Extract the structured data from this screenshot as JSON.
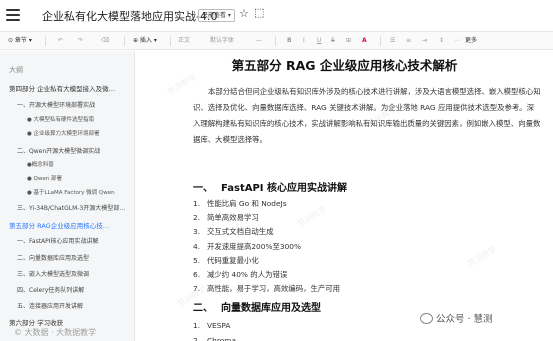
{
  "titlebar": {
    "title": "企业私有化大模型落地应用实战-4.0",
    "readonly": "只能查看 ▾",
    "star_icon": "☆",
    "cloud_icon": "⬚"
  },
  "toolbar": {
    "items": [
      "⊙ 章节 ▾",
      "↶",
      "↷",
      "⌫",
      "⊕ 插入 ▾",
      "正文",
      "默认字体",
      "—",
      "B",
      "⊞",
      "A",
      "更多"
    ],
    "insert": "⊕ 插入 ▾",
    "style": "正文",
    "font": "默认字体",
    "size": "—",
    "more": "更多",
    "undo": "↶",
    "redo": "↷",
    "clear": "⌫",
    "chapter": "⊙ 章节 ▾",
    "bold": "B",
    "table": "⊞",
    "color_a": "A"
  },
  "sidebar": {
    "title": "大纲",
    "items": [
      {
        "level": 1,
        "label": "第四部分 企业私有大模型接入及微…",
        "active": false
      },
      {
        "level": 2,
        "label": "一、开源大模型环境部署实战",
        "active": false
      },
      {
        "level": 3,
        "label": "● 大模型私有硬件选型指南",
        "active": false
      },
      {
        "level": 3,
        "label": "● 企业级算力大模型环境部署",
        "active": false
      },
      {
        "level": 2,
        "label": "二、Qwen开源大模型微调实战",
        "active": false
      },
      {
        "level": 3,
        "label": "●概念科普",
        "active": false
      },
      {
        "level": 3,
        "label": "● Qwen 部署",
        "active": false
      },
      {
        "level": 3,
        "label": "● 基于LLaMA Factory 微调 Qwen",
        "active": false
      },
      {
        "level": 2,
        "label": "三、Yi-34B/ChatGLM-3开源大模型部…",
        "active": false
      },
      {
        "level": 1,
        "label": "第五部分 RAG企业级应用核心技…",
        "active": true
      },
      {
        "level": 2,
        "label": "一、FastAPI核心应用实战讲解",
        "active": false
      },
      {
        "level": 2,
        "label": "二、向量数据库应用及选型",
        "active": false
      },
      {
        "level": 2,
        "label": "三、嵌入大模型选型及微调",
        "active": false
      },
      {
        "level": 2,
        "label": "四、Celery任务队列讲解",
        "active": false
      },
      {
        "level": 2,
        "label": "五、连接器应用开发讲解",
        "active": false
      },
      {
        "level": 1,
        "label": "第六部分 学习收获",
        "active": false
      }
    ]
  },
  "document": {
    "title": "第五部分 RAG 企业级应用核心技术解析",
    "intro": "本部分结合但问企业级私有知识库外涉及的核心技术进行讲解，涉及大语言模型选择、嵌入模型核心知识、选择及优化、向量数据库选择、RAG 关键技术讲解。为企业落地 RAG 应用提供技术选型及参考。深入理解构建私有知识库的核心技术，实战讲解影响私有知识库输出质量的关键因素，例如嵌入模型、向量数据库、大模型选择等。",
    "section1": {
      "num": "一、",
      "title": "FastAPI 核心应用实战讲解",
      "items": [
        "性能比肩 Go 和 NodeJs",
        "简单高效易学习",
        "交互式文档自动生成",
        "开发速度提高200%至300%",
        "代码重复最小化",
        "减少约 40% 的人为错误",
        "高性能，易于学习，高效编码，生产可用"
      ]
    },
    "section2": {
      "num": "二、",
      "title": "向量数据库应用及选型",
      "items": [
        "VESPA",
        "Chroma"
      ]
    }
  },
  "watermark": {
    "text": "慧测教学",
    "bottom": "© 大数据 · 大数据教学"
  },
  "brand": {
    "text": "公众号 · 慧测"
  }
}
